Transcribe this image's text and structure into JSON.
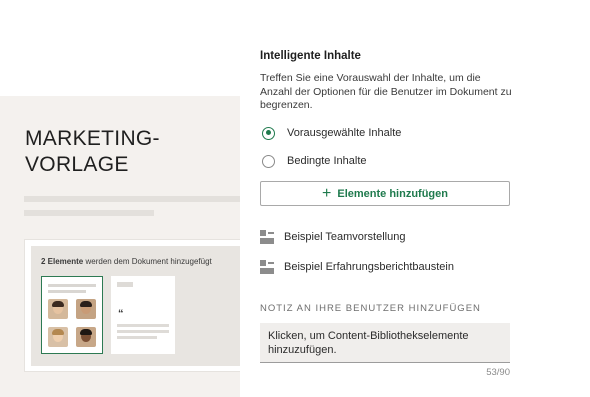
{
  "document_preview": {
    "title_line1": "MARKETING-",
    "title_line2": "VORLAGE",
    "caption_count": "2 Elemente",
    "caption_rest": " werden dem Dokument hinzugefügt",
    "quote_glyph": "“"
  },
  "smart_content": {
    "title": "Intelligente Inhalte",
    "description": "Treffen Sie eine Vorauswahl der Inhalte, um die Anzahl der Optionen für die Benutzer im Dokument zu begrenzen.",
    "options": [
      {
        "label": "Vorausgewählte Inhalte",
        "selected": true
      },
      {
        "label": "Bedingte Inhalte",
        "selected": false
      }
    ],
    "add_button_label": "Elemente hinzufügen",
    "items": [
      {
        "label": "Beispiel Teamvorstellung",
        "icon": "content-block-icon"
      },
      {
        "label": "Beispiel Erfahrungsberichtbaustein",
        "icon": "content-block-icon"
      }
    ]
  },
  "note": {
    "label": "NOTIZ AN IHRE BENUTZER HINZUFÜGEN",
    "value": "Klicken, um Content-Bibliothekselemente hinzuzufügen.",
    "counter": "53/90"
  },
  "colors": {
    "accent": "#1f7a4d",
    "preview_background": "#f4f1ee"
  }
}
